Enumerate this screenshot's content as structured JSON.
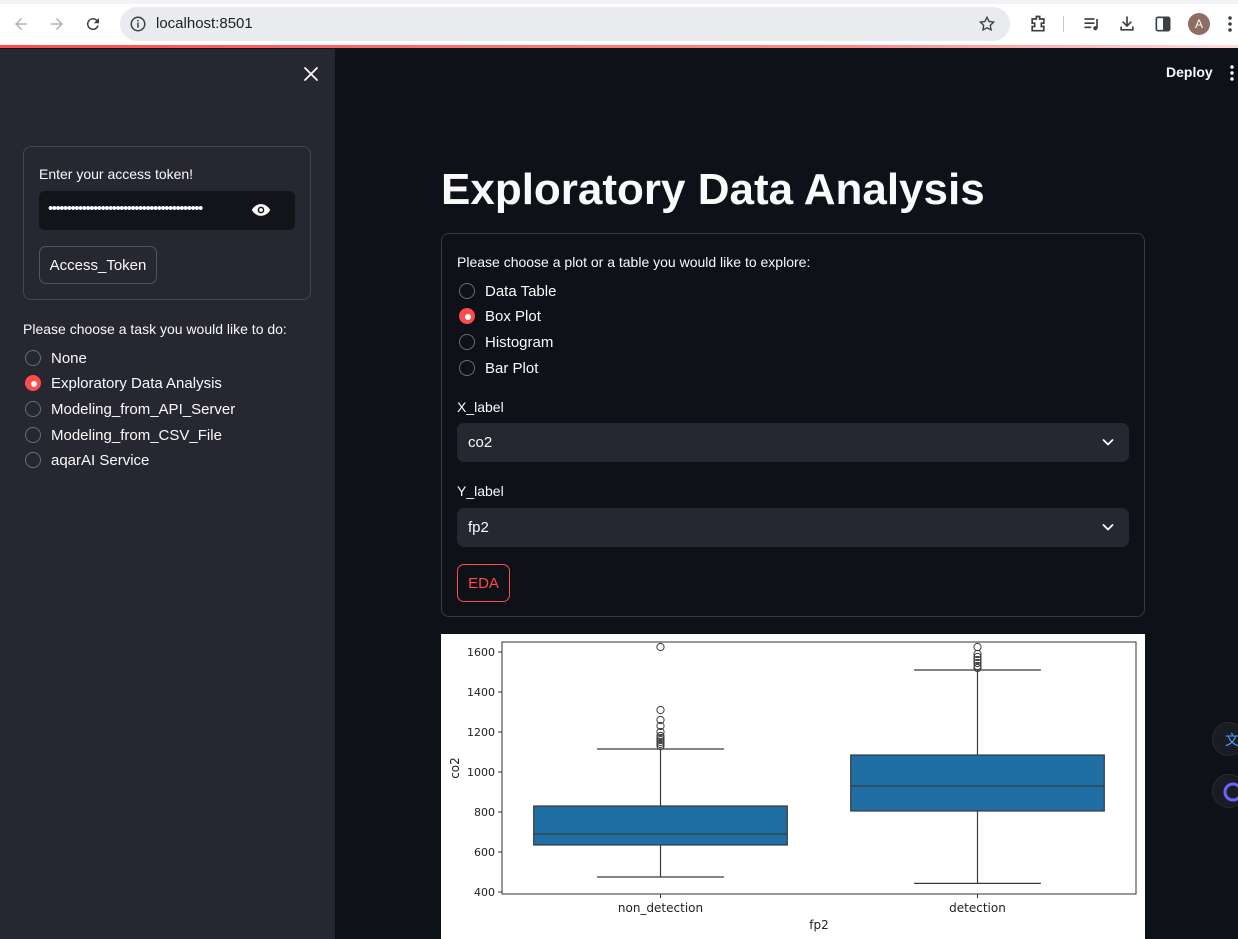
{
  "browser": {
    "url": "localhost:8501",
    "profile_initial": "A",
    "icons": [
      "back-icon",
      "forward-icon",
      "reload-icon",
      "info-icon",
      "star-icon",
      "extensions-icon",
      "media-icon",
      "download-icon",
      "sidepanel-icon",
      "menu-icon"
    ]
  },
  "sidebar": {
    "token_label": "Enter your access token!",
    "token_value": "•••••••••••••••••••••••••••••••••••••••••",
    "token_button": "Access_Token",
    "task_label": "Please choose a task you would like to do:",
    "tasks": [
      {
        "label": "None",
        "selected": false
      },
      {
        "label": "Exploratory Data Analysis",
        "selected": true
      },
      {
        "label": "Modeling_from_API_Server",
        "selected": false
      },
      {
        "label": "Modeling_from_CSV_File",
        "selected": false
      },
      {
        "label": "aqarAI Service",
        "selected": false
      }
    ]
  },
  "header": {
    "deploy_label": "Deploy"
  },
  "main": {
    "title": "Exploratory Data Analysis",
    "question": "Please choose a plot or a table you would like to explore:",
    "plot_options": [
      {
        "label": "Data Table",
        "selected": false
      },
      {
        "label": "Box Plot",
        "selected": true
      },
      {
        "label": "Histogram",
        "selected": false
      },
      {
        "label": "Bar Plot",
        "selected": false
      }
    ],
    "x_label_field": "X_label",
    "x_value": "co2",
    "y_label_field": "Y_label",
    "y_value": "fp2",
    "eda_button": "EDA"
  },
  "colors": {
    "accent": "#ff4b4b",
    "box_fill": "#1f6fa5",
    "sidebar_bg": "#262730",
    "main_bg": "#0e1117"
  },
  "chart_data": {
    "type": "box",
    "title": "",
    "xlabel": "fp2",
    "ylabel": "co2",
    "categories": [
      "non_detection",
      "detection"
    ],
    "ylim": [
      390,
      1650
    ],
    "yticks": [
      400,
      600,
      800,
      1000,
      1200,
      1400,
      1600
    ],
    "boxes": [
      {
        "category": "non_detection",
        "whisker_low": 475,
        "q1": 635,
        "median": 690,
        "q3": 830,
        "whisker_high": 1115,
        "outliers": [
          1130,
          1140,
          1150,
          1160,
          1170,
          1180,
          1200,
          1230,
          1260,
          1310,
          1625
        ]
      },
      {
        "category": "detection",
        "whisker_low": 443,
        "q1": 805,
        "median": 930,
        "q3": 1085,
        "whisker_high": 1510,
        "outliers": [
          1520,
          1530,
          1545,
          1560,
          1575,
          1590,
          1625
        ]
      }
    ]
  }
}
